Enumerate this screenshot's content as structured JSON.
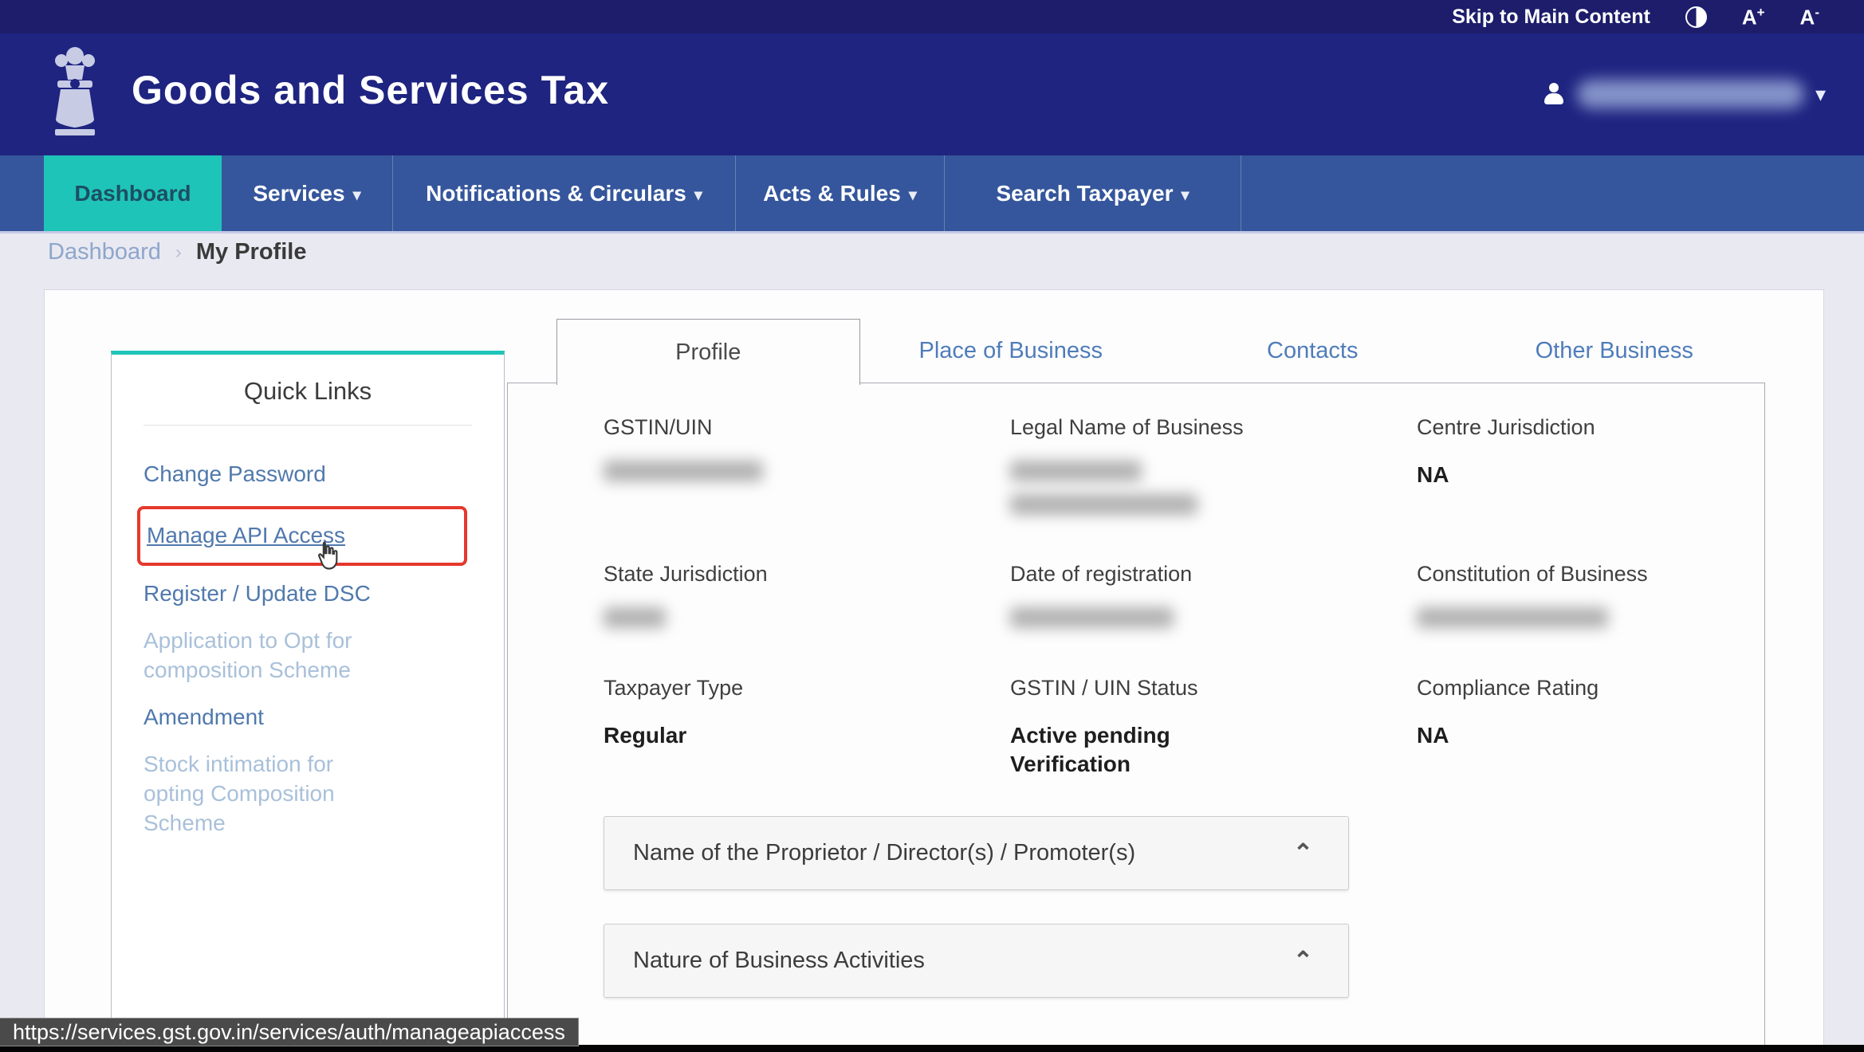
{
  "topbar": {
    "skip_link": "Skip to Main Content",
    "font_increase_base": "A",
    "font_increase_sign": "+",
    "font_decrease_base": "A",
    "font_decrease_sign": "-"
  },
  "header": {
    "title": "Goods and Services Tax"
  },
  "nav": {
    "items": [
      {
        "label": "Dashboard",
        "active": true
      },
      {
        "label": "Services",
        "caret": true
      },
      {
        "label": "Notifications & Circulars",
        "caret": true
      },
      {
        "label": "Acts & Rules",
        "caret": true
      },
      {
        "label": "Search Taxpayer",
        "caret": true
      }
    ]
  },
  "icons": {
    "caret_down": "▾",
    "user_caret": "▾",
    "breadcrumb_separator": "›",
    "collapse_caret": "⌃"
  },
  "breadcrumb": {
    "parent": "Dashboard",
    "current": "My Profile"
  },
  "sidebar": {
    "title": "Quick Links",
    "links": [
      {
        "label": "Change Password",
        "state": "enabled"
      },
      {
        "label": "Manage API Access",
        "state": "enabled",
        "highlighted": true
      },
      {
        "label": "Register / Update DSC",
        "state": "enabled"
      },
      {
        "label": "Application to Opt for composition Scheme",
        "state": "disabled"
      },
      {
        "label": "Amendment",
        "state": "enabled"
      },
      {
        "label": "Stock intimation for opting Composition Scheme",
        "state": "disabled"
      }
    ]
  },
  "tabs": {
    "active": "Profile",
    "items": [
      "Profile",
      "Place of Business",
      "Contacts",
      "Other Business"
    ]
  },
  "profile": {
    "fields": {
      "gstin": {
        "label": "GSTIN/UIN",
        "value": "",
        "redacted": true
      },
      "legal_name": {
        "label": "Legal Name of Business",
        "value": "",
        "redacted": true
      },
      "centre_jurisdiction": {
        "label": "Centre Jurisdiction",
        "value": "NA"
      },
      "state_jurisdiction": {
        "label": "State Jurisdiction",
        "value": "",
        "redacted": true
      },
      "date_of_registration": {
        "label": "Date of registration",
        "value": "",
        "redacted": true
      },
      "constitution_of_business": {
        "label": "Constitution of Business",
        "value": "",
        "redacted": true
      },
      "taxpayer_type": {
        "label": "Taxpayer Type",
        "value": "Regular"
      },
      "gstin_uin_status": {
        "label": "GSTIN / UIN Status",
        "value": "Active pending Verification"
      },
      "compliance_rating": {
        "label": "Compliance Rating",
        "value": "NA"
      }
    }
  },
  "accordions": [
    {
      "title": "Name of the Proprietor / Director(s) / Promoter(s)"
    },
    {
      "title": "Nature of Business Activities"
    }
  ],
  "status_tooltip": {
    "url": "https://services.gst.gov.in/services/auth/manageapiaccess"
  },
  "colors": {
    "topbar_navy": "#1d1d6b",
    "header_navy": "#1e2480",
    "nav_blue": "#35569c",
    "teal_accent": "#1fc4b9",
    "link_blue": "#5079ad",
    "disabled_link_blue": "#a9c0da",
    "tab_link_blue": "#4f7cba",
    "highlight_red": "#e5382c",
    "page_background": "#e9e9f2",
    "tooltip_grey": "#4a4a4a"
  }
}
